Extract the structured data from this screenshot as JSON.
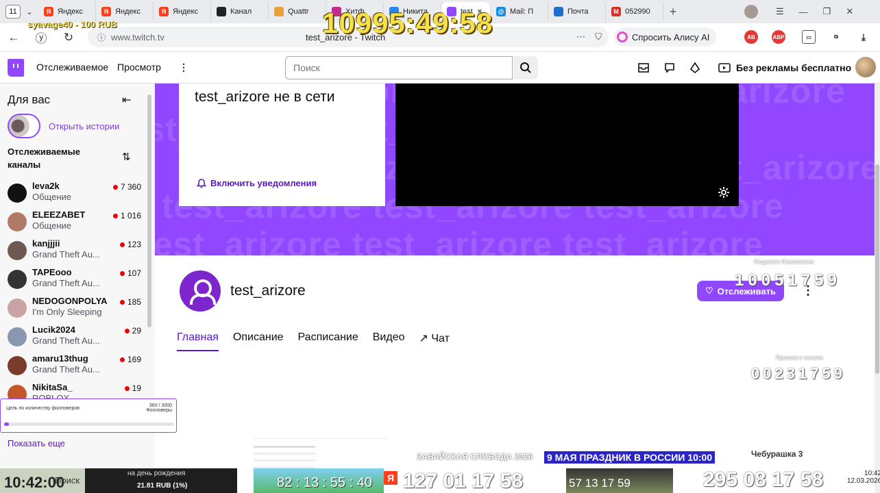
{
  "browser": {
    "tab_count": "11",
    "tabs": [
      {
        "label": "Яндекс",
        "fav": "Я",
        "color": "#fc3f1d"
      },
      {
        "label": "Яндекс",
        "fav": "Я",
        "color": "#fc3f1d"
      },
      {
        "label": "Яндекс",
        "fav": "Я",
        "color": "#fc3f1d"
      },
      {
        "label": "Канал",
        "fav": "",
        "color": "#222222"
      },
      {
        "label": "Quattr",
        "fav": "",
        "color": "#e8a23c"
      },
      {
        "label": "Хитф",
        "fav": "",
        "color": "#c12c8f"
      },
      {
        "label": "Никита",
        "fav": "",
        "color": "#2787f5"
      },
      {
        "label": "test",
        "fav": "",
        "color": "#9147ff"
      },
      {
        "label": "Mail: П",
        "fav": "@",
        "color": "#168de2"
      },
      {
        "label": "Почта",
        "fav": "",
        "color": "#1f6fd0"
      },
      {
        "label": "052990",
        "fav": "M",
        "color": "#d93025"
      }
    ],
    "url": "www.twitch.tv",
    "page_title": "test_arizore - Twitch",
    "alice_label": "Спросить Алису AI"
  },
  "twitch_header": {
    "nav_following": "Отслеживаемое",
    "nav_browse": "Просмотр",
    "search_placeholder": "Поиск",
    "no_ads": "Без рекламы бесплатно"
  },
  "sidebar": {
    "for_you": "Для вас",
    "stories": "Открыть истории",
    "followed_title": "Отслеживаемые каналы",
    "show_more": "Показать еще",
    "channels": [
      {
        "name": "leva2k",
        "game": "Общение",
        "viewers": "7 360",
        "color": "#111111"
      },
      {
        "name": "ELEEZABET",
        "game": "Общение",
        "viewers": "1 016",
        "color": "#b07a66"
      },
      {
        "name": "kanjjjii",
        "game": "Grand Theft Au...",
        "viewers": "123",
        "color": "#6e5a50"
      },
      {
        "name": "TAPEooo",
        "game": "Grand Theft Au...",
        "viewers": "107",
        "color": "#333333"
      },
      {
        "name": "NEDOGONPOLYA",
        "game": "I'm Only Sleeping",
        "viewers": "185",
        "color": "#c9a3a3"
      },
      {
        "name": "Lucik2024",
        "game": "Grand Theft Au...",
        "viewers": "29",
        "color": "#8a97b0"
      },
      {
        "name": "amaru13thug",
        "game": "Grand Theft Au...",
        "viewers": "169",
        "color": "#7a3b2b"
      },
      {
        "name": "NikitaSa_",
        "game": "ROBLOX",
        "viewers": "19",
        "color": "#c4562c"
      }
    ]
  },
  "channel": {
    "offline_name": "test_arizore",
    "offline_suffix": " не в сети",
    "notify": "Включить уведомления",
    "name": "test_arizore",
    "follow": "Отслеживать",
    "watermark": "test_arizore test_arizore test_arizore",
    "tabs": [
      "Главная",
      "Описание",
      "Расписание",
      "Видео",
      "Чат"
    ]
  },
  "overlays": {
    "big_timer": "10995:49:58",
    "donation_line": "syavage40 - 100 RUB",
    "countdown1_title": "Людмила Николаевна",
    "countdown1": [
      "10",
      "05",
      "17",
      "59"
    ],
    "countdown2_title": "Прошло с начала",
    "countdown2": [
      "00",
      "23",
      "17",
      "59"
    ],
    "goal_title": "Цель по количеству фолловеров",
    "goal_value": "360 / 3000",
    "goal_sub": "Фолловеры",
    "goal_progress_pct": 3,
    "bottom_clock": "10:42:00",
    "bottom_search": "Поиск",
    "donation_money": "21.81 RUB (1%)",
    "donation_label": "на день рождения",
    "timer_a": "82 : 13 : 55 : 40",
    "timer_b": "127  01  17  58",
    "timer_c": "57   13   17   59",
    "timer_d": "295 08 17 58",
    "ticker": "9 МАЯ ПРАЗДНИК В РОССИИ 10:00",
    "ticker_left": "ЗАВАЙСКАЯ СЛОБОДА 2026",
    "ticker_right": "Чебурашка 3",
    "tray_time": "10:42",
    "tray_date": "12.03.2026"
  }
}
